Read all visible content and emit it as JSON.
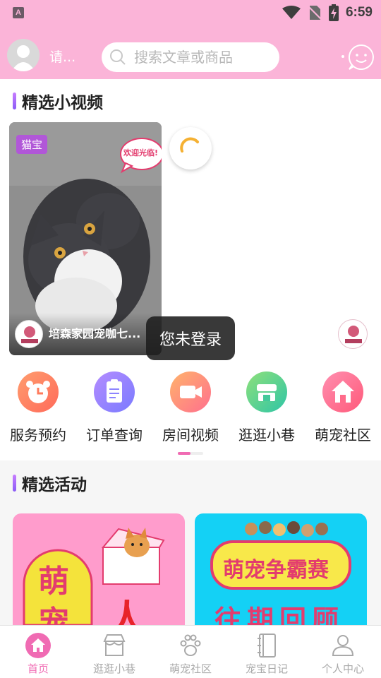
{
  "status_bar": {
    "time": "6:59",
    "app_badge": "A"
  },
  "header": {
    "login_hint": "请...",
    "search_placeholder": "搜索文章或商品"
  },
  "videos_section": {
    "title": "精选小视频",
    "video": {
      "tag": "猫宝",
      "title": "培森家园宠咖七...",
      "bubble": "欢迎光临!"
    }
  },
  "toast": "您未登录",
  "quick_nav": [
    {
      "label": "服务预约",
      "icon": "alarm-clock-icon"
    },
    {
      "label": "订单查询",
      "icon": "clipboard-icon"
    },
    {
      "label": "房间视频",
      "icon": "video-camera-icon"
    },
    {
      "label": "逛逛小巷",
      "icon": "storefront-icon"
    },
    {
      "label": "萌宠社区",
      "icon": "house-icon"
    }
  ],
  "activities_section": {
    "title": "精选活动",
    "cards": [
      {
        "text_1": "萌",
        "text_2": "宠",
        "text_3": "人"
      },
      {
        "banner": "萌宠争霸赛",
        "subtitle": "往期回顾"
      }
    ]
  },
  "tabs": [
    {
      "label": "首页",
      "icon": "home-icon",
      "active": true
    },
    {
      "label": "逛逛小巷",
      "icon": "shop-icon",
      "active": false
    },
    {
      "label": "萌宠社区",
      "icon": "paw-icon",
      "active": false
    },
    {
      "label": "宠宝日记",
      "icon": "notebook-icon",
      "active": false
    },
    {
      "label": "个人中心",
      "icon": "person-icon",
      "active": false
    }
  ],
  "colors": {
    "header_bg": "#fbb4d8",
    "accent": "#f06bb3"
  }
}
